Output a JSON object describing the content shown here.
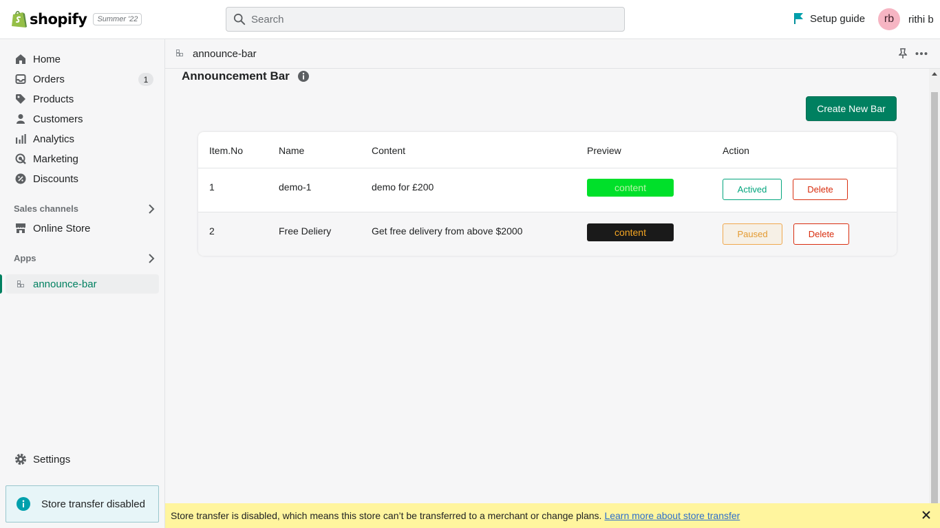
{
  "topbar": {
    "brand": "shopify",
    "edition": "Summer '22",
    "search_placeholder": "Search",
    "setup_guide": "Setup guide",
    "user_initials": "rb",
    "user_name": "rithi b"
  },
  "sidebar": {
    "items": [
      {
        "label": "Home",
        "icon": "home-icon"
      },
      {
        "label": "Orders",
        "icon": "orders-icon",
        "badge": "1"
      },
      {
        "label": "Products",
        "icon": "tag-icon"
      },
      {
        "label": "Customers",
        "icon": "person-icon"
      },
      {
        "label": "Analytics",
        "icon": "bar-chart-icon"
      },
      {
        "label": "Marketing",
        "icon": "target-icon"
      },
      {
        "label": "Discounts",
        "icon": "discount-icon"
      }
    ],
    "sales_channels": "Sales channels",
    "online_store": "Online Store",
    "apps": "Apps",
    "active_app": "announce-bar",
    "settings": "Settings",
    "transfer_notice": "Store transfer disabled"
  },
  "app_header": {
    "title": "announce-bar"
  },
  "page": {
    "title": "Announcement Bar",
    "create_button": "Create New Bar"
  },
  "table": {
    "headers": [
      "Item.No",
      "Name",
      "Content",
      "Preview",
      "Action"
    ],
    "rows": [
      {
        "no": "1",
        "name": "demo-1",
        "content": "demo for £200",
        "preview": "content",
        "preview_bg": "#00e02a",
        "preview_fg": "#b8f5a8",
        "status": "Actived",
        "delete": "Delete"
      },
      {
        "no": "2",
        "name": "Free Deliery",
        "content": "Get free delivery from above $2000",
        "preview": "content",
        "preview_bg": "#1a1a1a",
        "preview_fg": "#f5a623",
        "status": "Paused",
        "delete": "Delete"
      }
    ]
  },
  "banner": {
    "text": "Store transfer is disabled, which means this store can’t be transferred to a merchant or change plans.",
    "link": "Learn more about store transfer"
  },
  "colors": {
    "brand_green": "#008060",
    "active_green": "#00a47c",
    "paused_orange": "#e49a30",
    "delete_red": "#d82c0d",
    "banner_yellow": "#fff59e"
  }
}
